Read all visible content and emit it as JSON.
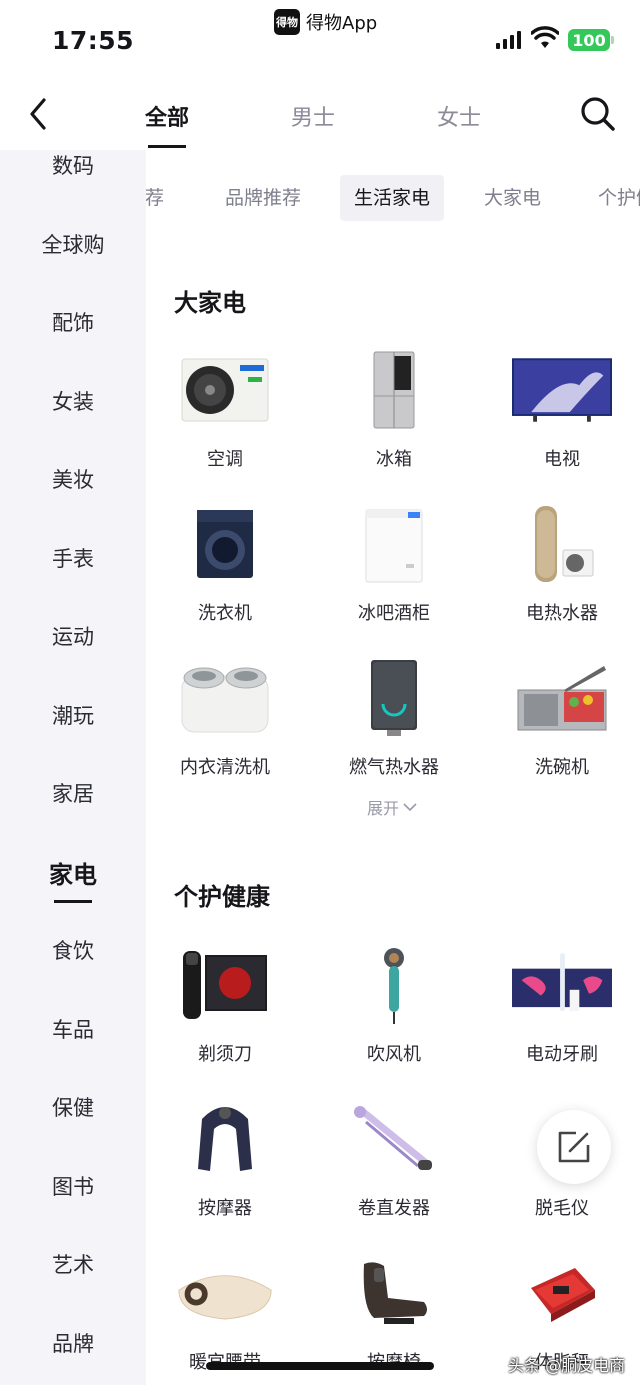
{
  "status_bar": {
    "time": "17:55",
    "app_logo_text": "得物",
    "app_name": "得物App",
    "battery": "100",
    "battery_color": "#34c759"
  },
  "header": {
    "tabs": [
      {
        "label": "全部",
        "active": true
      },
      {
        "label": "男士",
        "active": false
      },
      {
        "label": "女士",
        "active": false
      }
    ],
    "back_icon": "chevron-left-icon",
    "search_icon": "search-icon"
  },
  "sidebar": {
    "items": [
      {
        "label": "数码"
      },
      {
        "label": "全球购"
      },
      {
        "label": "配饰"
      },
      {
        "label": "女装"
      },
      {
        "label": "美妆"
      },
      {
        "label": "手表"
      },
      {
        "label": "运动"
      },
      {
        "label": "潮玩"
      },
      {
        "label": "家居"
      },
      {
        "label": "家电",
        "active": true
      },
      {
        "label": "食饮"
      },
      {
        "label": "车品"
      },
      {
        "label": "保健"
      },
      {
        "label": "图书"
      },
      {
        "label": "艺术"
      },
      {
        "label": "品牌"
      }
    ]
  },
  "subtabs": [
    {
      "label": "推荐"
    },
    {
      "label": "品牌推荐"
    },
    {
      "label": "生活家电",
      "active": true
    },
    {
      "label": "大家电"
    },
    {
      "label": "个护健康"
    }
  ],
  "sections": [
    {
      "title": "大家电",
      "items": [
        {
          "label": "空调",
          "icon": "air-conditioner-icon"
        },
        {
          "label": "冰箱",
          "icon": "refrigerator-icon"
        },
        {
          "label": "电视",
          "icon": "tv-icon"
        },
        {
          "label": "洗衣机",
          "icon": "washing-machine-icon"
        },
        {
          "label": "冰吧酒柜",
          "icon": "chest-freezer-icon"
        },
        {
          "label": "电热水器",
          "icon": "water-heater-icon"
        },
        {
          "label": "内衣清洗机",
          "icon": "underwear-washer-icon"
        },
        {
          "label": "燃气热水器",
          "icon": "gas-water-heater-icon"
        },
        {
          "label": "洗碗机",
          "icon": "dishwasher-icon"
        }
      ],
      "expand_label": "展开"
    },
    {
      "title": "个护健康",
      "items": [
        {
          "label": "剃须刀",
          "icon": "shaver-icon"
        },
        {
          "label": "吹风机",
          "icon": "hair-dryer-icon"
        },
        {
          "label": "电动牙刷",
          "icon": "electric-toothbrush-icon"
        },
        {
          "label": "按摩器",
          "icon": "neck-massager-icon"
        },
        {
          "label": "卷直发器",
          "icon": "hair-curler-icon"
        },
        {
          "label": "脱毛仪",
          "icon": "hair-removal-icon"
        },
        {
          "label": "暖宫腰带",
          "icon": "warming-belt-icon"
        },
        {
          "label": "按摩椅",
          "icon": "massage-chair-icon"
        },
        {
          "label": "体脂秤",
          "icon": "body-scale-icon"
        }
      ]
    }
  ],
  "fab_icon": "edit-icon",
  "watermark": "头条 @胴皮电商"
}
